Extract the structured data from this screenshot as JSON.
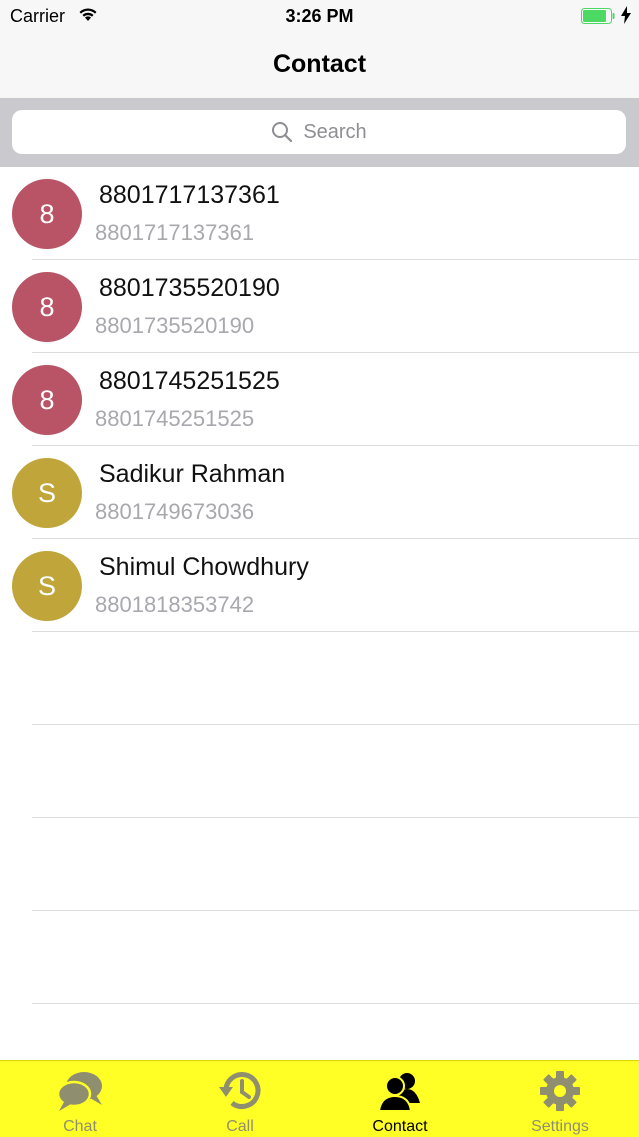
{
  "status_bar": {
    "carrier": "Carrier",
    "time": "3:26 PM"
  },
  "nav": {
    "title": "Contact"
  },
  "search": {
    "placeholder": "Search"
  },
  "contacts": [
    {
      "initial": "8",
      "name": "8801717137361",
      "phone": "8801717137361",
      "color": "#b85466"
    },
    {
      "initial": "8",
      "name": "8801735520190",
      "phone": "8801735520190",
      "color": "#b85466"
    },
    {
      "initial": "8",
      "name": "8801745251525",
      "phone": "8801745251525",
      "color": "#b85466"
    },
    {
      "initial": "S",
      "name": "Sadikur Rahman",
      "phone": "8801749673036",
      "color": "#bfa53a"
    },
    {
      "initial": "S",
      "name": "Shimul Chowdhury",
      "phone": "8801818353742",
      "color": "#bfa53a"
    }
  ],
  "tabs": [
    {
      "label": "Chat",
      "icon": "chat-bubbles-icon",
      "active": false
    },
    {
      "label": "Call",
      "icon": "call-history-icon",
      "active": false
    },
    {
      "label": "Contact",
      "icon": "contacts-icon",
      "active": true
    },
    {
      "label": "Settings",
      "icon": "gear-icon",
      "active": false
    }
  ],
  "colors": {
    "tab_bar": "#ffff26",
    "battery": "#4cd964"
  }
}
